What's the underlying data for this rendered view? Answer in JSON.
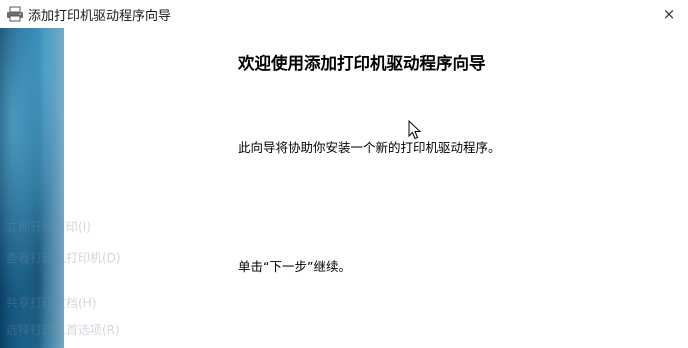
{
  "window": {
    "title": "添加打印机驱动程序向导",
    "close_label": "×",
    "title_icon": "printer-icon"
  },
  "wizard": {
    "heading": "欢迎使用添加打印机驱动程序向导",
    "description": "此向导将协助你安装一个新的打印机驱动程序。",
    "continue_hint": "单击“下一步”继续。"
  },
  "background_hint": {
    "items": [
      "立即开始打印(I)",
      "查看打印机打印机(D)",
      "共享打印文档(H)",
      "选择打印机首选项(R)"
    ]
  },
  "colors": {
    "banner_dark": "#0b3f63",
    "banner_light": "#3a93bf"
  }
}
